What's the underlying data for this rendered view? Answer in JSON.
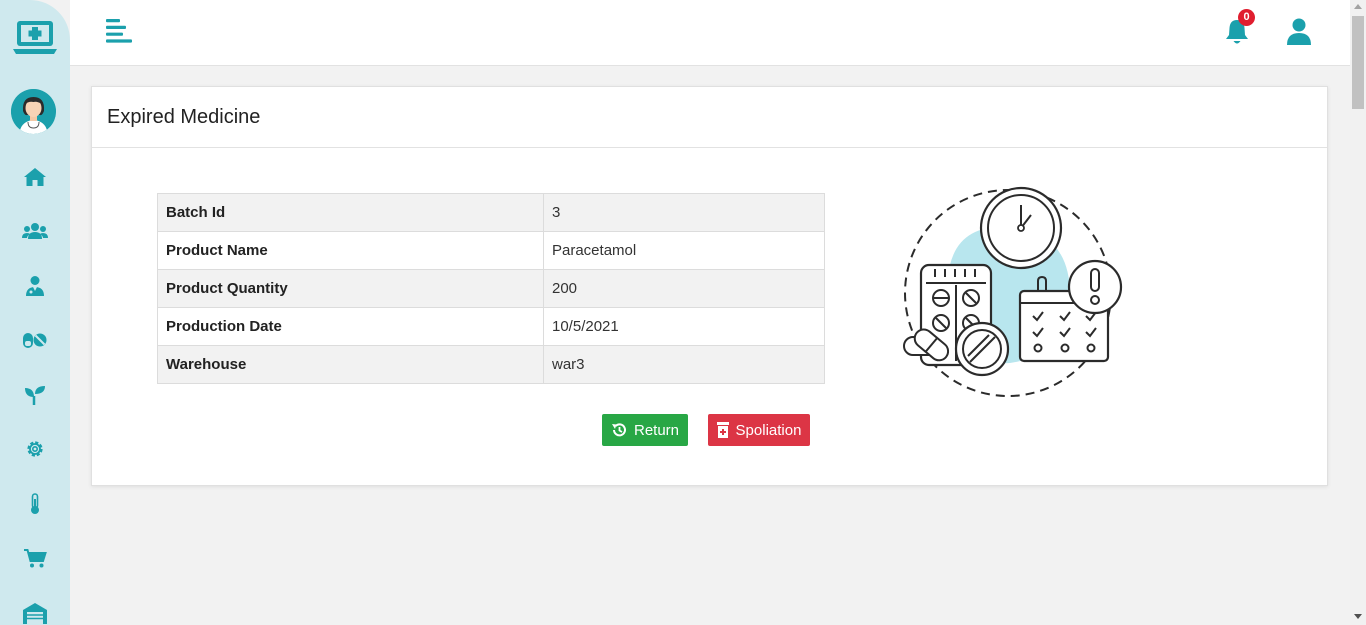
{
  "colors": {
    "accent": "#1ba0ac",
    "sidebar_bg": "#cfe9ee",
    "return_button": "#28a745",
    "spoliation_button": "#dc3545",
    "badge": "#e01e2f"
  },
  "sidebar": {
    "logo_icon": "hospital-laptop-icon",
    "avatar": "doctor-avatar",
    "items": [
      {
        "icon": "home-icon"
      },
      {
        "icon": "users-icon"
      },
      {
        "icon": "doctor-icon"
      },
      {
        "icon": "pills-icon"
      },
      {
        "icon": "seedling-icon"
      },
      {
        "icon": "gear-icon"
      },
      {
        "icon": "thermometer-icon"
      },
      {
        "icon": "cart-icon"
      },
      {
        "icon": "warehouse-icon"
      }
    ]
  },
  "topbar": {
    "menu_icon": "menu-align-icon",
    "notification_count": "0",
    "user_icon": "user-icon"
  },
  "card": {
    "title": "Expired Medicine",
    "rows": [
      {
        "label": "Batch Id",
        "value": "3"
      },
      {
        "label": "Product Name",
        "value": "Paracetamol"
      },
      {
        "label": "Product Quantity",
        "value": "200"
      },
      {
        "label": "Production Date",
        "value": "10/5/2021"
      },
      {
        "label": "Warehouse",
        "value": "war3"
      }
    ],
    "buttons": {
      "return_label": "Return",
      "spoliation_label": "Spoliation"
    },
    "illustration": "expired-medicine-illustration"
  }
}
